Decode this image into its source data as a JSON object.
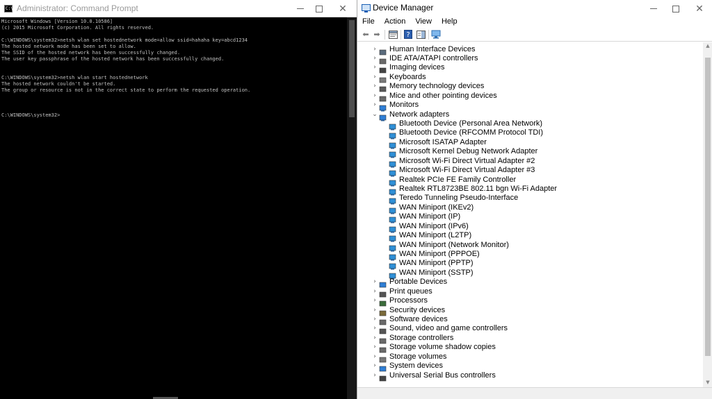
{
  "cmd": {
    "title": "Administrator: Command Prompt",
    "icon_text": "C:\\",
    "console_lines": [
      "Microsoft Windows [Version 10.0.10586]",
      "(c) 2015 Microsoft Corporation. All rights reserved.",
      "",
      "C:\\WINDOWS\\system32>netsh wlan set hostednetwork mode=allow ssid=hahaha key=abcd1234",
      "The hosted network mode has been set to allow.",
      "The SSID of the hosted network has been successfully changed.",
      "The user key passphrase of the hosted network has been successfully changed.",
      "",
      "",
      "C:\\WINDOWS\\system32>netsh wlan start hostednetwork",
      "The hosted network couldn't be started.",
      "The group or resource is not in the correct state to perform the requested operation.",
      "",
      "",
      "",
      "C:\\WINDOWS\\system32>"
    ],
    "console_fg": "#c0c0c0",
    "console_bg": "#000000"
  },
  "device_manager": {
    "title": "Device Manager",
    "menu": [
      "File",
      "Action",
      "View",
      "Help"
    ],
    "toolbar_icons": [
      "back-arrow-icon",
      "forward-arrow-icon",
      "properties-icon",
      "help-icon",
      "action-pane-icon",
      "scan-hardware-icon"
    ],
    "categories_before": [
      {
        "label": "Human Interface Devices",
        "icon": "hid-icon",
        "color": "#5a6b7d"
      },
      {
        "label": "IDE ATA/ATAPI controllers",
        "icon": "ide-controller-icon",
        "color": "#6a6a6a"
      },
      {
        "label": "Imaging devices",
        "icon": "camera-icon",
        "color": "#444444"
      },
      {
        "label": "Keyboards",
        "icon": "keyboard-icon",
        "color": "#7a7a7a"
      },
      {
        "label": "Memory technology devices",
        "icon": "memory-icon",
        "color": "#5a5a5a"
      },
      {
        "label": "Mice and other pointing devices",
        "icon": "mouse-icon",
        "color": "#6a6a6a"
      },
      {
        "label": "Monitors",
        "icon": "monitor-icon",
        "color": "#2f7fd6"
      }
    ],
    "expanded_category": {
      "label": "Network adapters",
      "icon": "network-adapter-icon",
      "color": "#2f7fd6"
    },
    "network_adapters": [
      "Bluetooth Device (Personal Area Network)",
      "Bluetooth Device (RFCOMM Protocol TDI)",
      "Microsoft ISATAP Adapter",
      "Microsoft Kernel Debug Network Adapter",
      "Microsoft Wi-Fi Direct Virtual Adapter #2",
      "Microsoft Wi-Fi Direct Virtual Adapter #3",
      "Realtek PCIe FE Family Controller",
      "Realtek RTL8723BE 802.11 bgn Wi-Fi Adapter",
      "Teredo Tunneling Pseudo-Interface",
      "WAN Miniport (IKEv2)",
      "WAN Miniport (IP)",
      "WAN Miniport (IPv6)",
      "WAN Miniport (L2TP)",
      "WAN Miniport (Network Monitor)",
      "WAN Miniport (PPPOE)",
      "WAN Miniport (PPTP)",
      "WAN Miniport (SSTP)"
    ],
    "categories_after": [
      {
        "label": "Portable Devices",
        "icon": "portable-device-icon",
        "color": "#2f7fd6"
      },
      {
        "label": "Print queues",
        "icon": "printer-icon",
        "color": "#555555"
      },
      {
        "label": "Processors",
        "icon": "processor-icon",
        "color": "#3b6d3b"
      },
      {
        "label": "Security devices",
        "icon": "security-device-icon",
        "color": "#7a6a3a"
      },
      {
        "label": "Software devices",
        "icon": "software-device-icon",
        "color": "#6a6a6a"
      },
      {
        "label": "Sound, video and game controllers",
        "icon": "speaker-icon",
        "color": "#555555"
      },
      {
        "label": "Storage controllers",
        "icon": "storage-controller-icon",
        "color": "#6a6a6a"
      },
      {
        "label": "Storage volume shadow copies",
        "icon": "shadow-copy-icon",
        "color": "#6a6a6a"
      },
      {
        "label": "Storage volumes",
        "icon": "storage-volume-icon",
        "color": "#777777"
      },
      {
        "label": "System devices",
        "icon": "system-device-icon",
        "color": "#2f7fd6"
      },
      {
        "label": "Universal Serial Bus controllers",
        "icon": "usb-icon",
        "color": "#444444"
      }
    ],
    "adapter_icon_color": "#2f8fd6"
  }
}
